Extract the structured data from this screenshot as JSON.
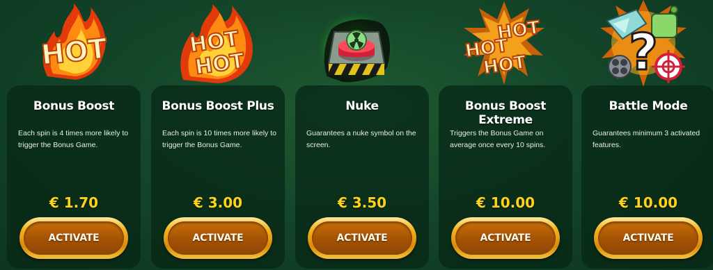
{
  "currency_symbol": "€",
  "button_label": "ACTIVATE",
  "cards": [
    {
      "title": "Bonus Boost",
      "description": "Each spin is 4 times more likely to trigger the Bonus Game.",
      "price": "€ 1.70",
      "icon": "hot-fire-icon"
    },
    {
      "title": "Bonus Boost Plus",
      "description": "Each spin is 10 times more likely to trigger the Bonus Game.",
      "price": "€ 3.00",
      "icon": "hot-hot-fire-icon"
    },
    {
      "title": "Nuke",
      "description": "Guarantees a nuke symbol on the screen.",
      "price": "€ 3.50",
      "icon": "nuke-button-icon"
    },
    {
      "title": "Bonus Boost Extreme",
      "description": "Triggers the Bonus Game on average once every 10 spins.",
      "price": "€ 10.00",
      "icon": "hot-hot-hot-explosion-icon"
    },
    {
      "title": "Battle Mode",
      "description": "Guarantees minimum 3 activated features.",
      "price": "€ 10.00",
      "icon": "battle-mode-question-icon"
    }
  ],
  "hot_text": "HOT",
  "colors": {
    "background": "#14472a",
    "card": "#08281a",
    "price": "#ffd21a",
    "button_gold": "#f4b21e",
    "button_inner": "#a35205",
    "fire": "#ff6a00",
    "nuke_glow": "#39ff3a"
  }
}
